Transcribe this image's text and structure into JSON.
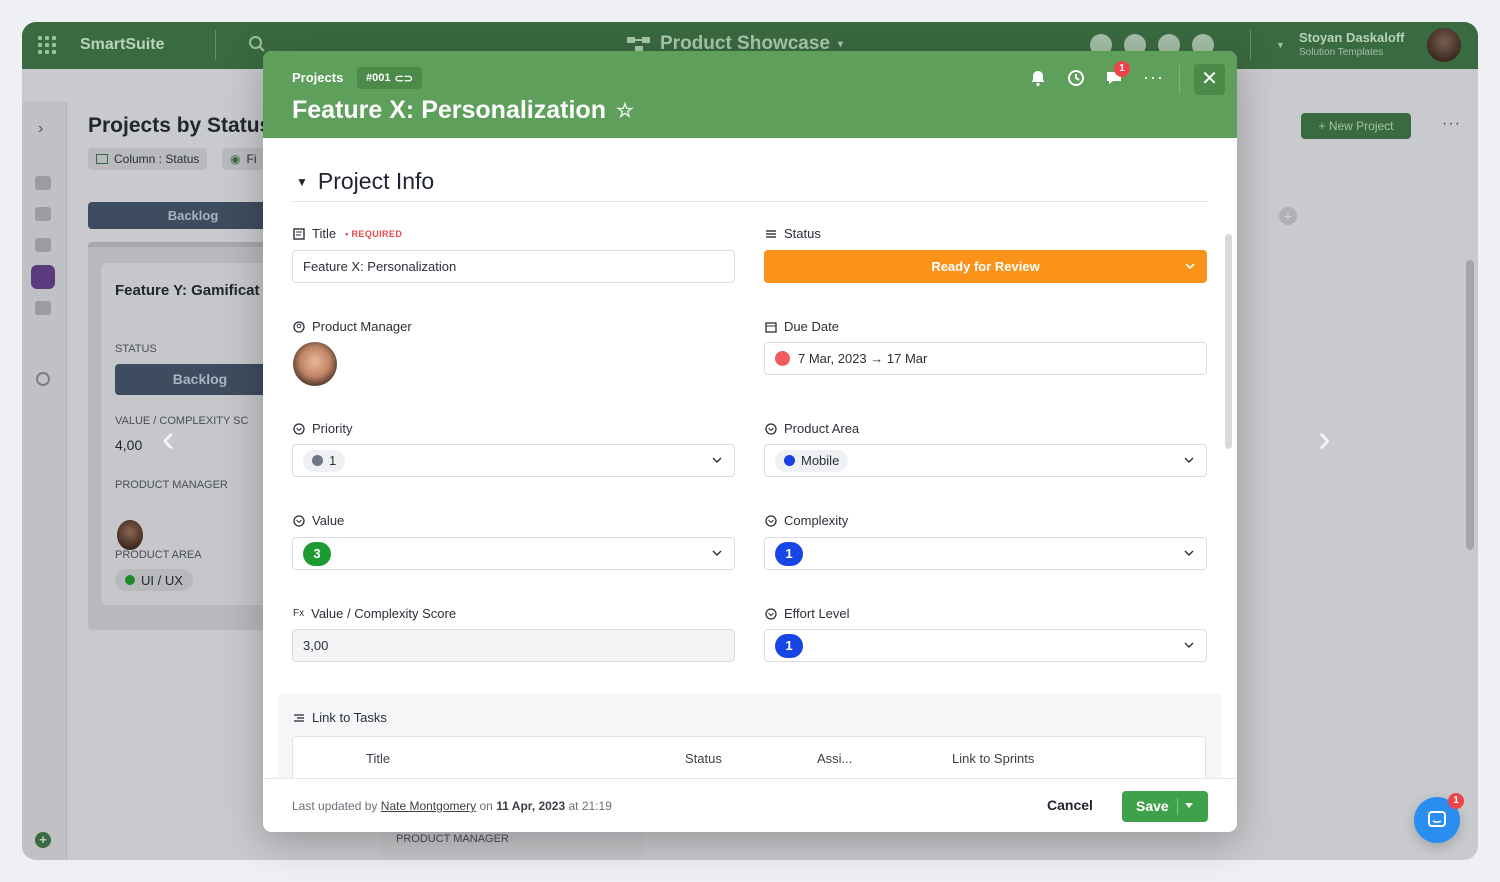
{
  "app": {
    "brand": "SmartSuite",
    "workspace": "Product Showcase",
    "user_name": "Stoyan Daskaloff",
    "user_role": "Solution Templates"
  },
  "background": {
    "page_title": "Projects by Status",
    "chip_column": "Column : Status",
    "chip_fields": "Fi",
    "column_header": "Backlog",
    "card_title": "Feature Y: Gamificat",
    "card_status_label": "STATUS",
    "card_status_value": "Backlog",
    "card_score_label": "VALUE / COMPLEXITY SC",
    "card_score_value": "4,00",
    "card_pm_label": "PRODUCT MANAGER",
    "card_area_label": "PRODUCT AREA",
    "card_area_value": "UI / UX",
    "new_project": "New Project",
    "bottom_card_label": "PRODUCT MANAGER"
  },
  "modal": {
    "breadcrumb": "Projects",
    "record_id": "#001",
    "title": "Feature X: Personalization",
    "comments_badge": "1",
    "section_title": "Project Info",
    "fields": {
      "title_label": "Title",
      "title_required": "• REQUIRED",
      "title_value": "Feature X: Personalization",
      "status_label": "Status",
      "status_value": "Ready for Review",
      "status_color": "#fb9219",
      "pm_label": "Product Manager",
      "due_label": "Due Date",
      "due_value": "7 Mar, 2023 → 17 Mar",
      "priority_label": "Priority",
      "priority_value": "1",
      "area_label": "Product Area",
      "area_value": "Mobile",
      "value_label": "Value",
      "value_value": "3",
      "complexity_label": "Complexity",
      "complexity_value": "1",
      "score_label": "Value / Complexity Score",
      "score_value": "3,00",
      "effort_label": "Effort Level",
      "effort_value": "1"
    },
    "link_tasks": {
      "label": "Link to Tasks",
      "columns": [
        "Title",
        "Status",
        "Assi...",
        "Link to Sprints"
      ]
    },
    "footer": {
      "updated_prefix": "Last updated",
      "by": "by",
      "who": "Nate Montgomery",
      "on": "on",
      "date": "11 Apr, 2023",
      "at": "at 21:19",
      "cancel": "Cancel",
      "save": "Save"
    }
  },
  "chat_badge": "1"
}
